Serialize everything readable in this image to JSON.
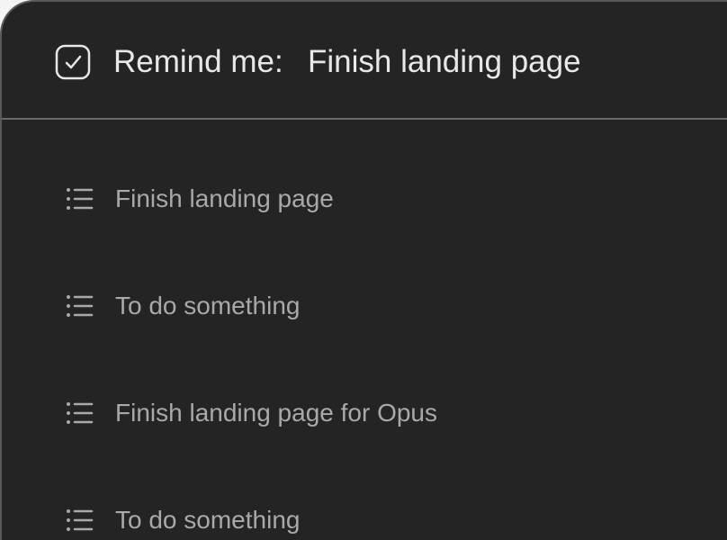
{
  "header": {
    "label": "Remind me:",
    "value": "Finish landing page",
    "icon": "checkbox-checked-icon"
  },
  "suggestions": [
    {
      "text": "Finish landing page",
      "icon": "list-icon"
    },
    {
      "text": "To do something",
      "icon": "list-icon"
    },
    {
      "text": "Finish landing page for Opus",
      "icon": "list-icon"
    },
    {
      "text": "To do something",
      "icon": "list-icon"
    }
  ],
  "colors": {
    "panel_background": "#242424",
    "header_text": "#e8e8e8",
    "item_text": "#a9a9a9",
    "divider": "#6a6a6a"
  }
}
